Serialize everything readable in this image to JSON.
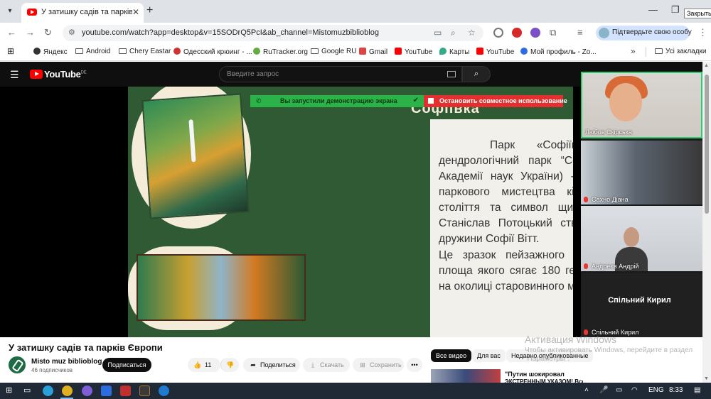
{
  "browser": {
    "tab_title": "У затишку садів та парків Європ",
    "tooltip_close": "Закрыть",
    "url": "youtube.com/watch?app=desktop&v=15SODrQ5PcI&ab_channel=Mistomuzbiblioblog",
    "profile_label": "Підтвердьте свою особу",
    "bookmarks": [
      "Яндекс",
      "Android",
      "Chery Eastar",
      "Одесский крюинг - ...",
      "RuTracker.org",
      "Google RU",
      "Gmail",
      "YouTube",
      "Карты",
      "YouTube",
      "Мой профиль - Zo..."
    ],
    "all_bookmarks": "Усі закладки"
  },
  "youtube": {
    "logo_text": "YouTube",
    "region": "DE",
    "search_placeholder": "Введите запрос"
  },
  "meeting": {
    "share_banner": "Вы запустили демонстрацию экрана",
    "stop_sharing": "Остановить совместное использование",
    "participants": [
      {
        "name": "Любов Скірська"
      },
      {
        "name": "Сахно Діана"
      },
      {
        "name": "Андреєв Андрій"
      },
      {
        "name": "Спільний Кирил",
        "display": "Спільний Кирил"
      }
    ]
  },
  "slide": {
    "heading": "Софіївка",
    "paragraph1": "Парк «Софіївка» (Національний дендрологічний парк “Софіївка” Національної Академії наук України) - це перлина садово-паркового мистецтва кінця 18 початок 19 століття та символ щирого кохання , який Станіслав Потоцький створив на честь своєї дружини Софії Вітт.",
    "paragraph2": "Це зразок пейзажного паркового мистецтва, площа якого сягає 180 гектарів і розташований на околиці старовинного міста Умані."
  },
  "video": {
    "title": "У затишку садів та парків Європи",
    "channel": "Misto muz biblioblog",
    "subscribers": "46 подписчиков",
    "subscribe": "Подписаться",
    "likes": "11",
    "share": "Поделиться",
    "download": "Скачать",
    "save": "Сохранить",
    "more": "•••"
  },
  "sidebar": {
    "chips": [
      "Все видео",
      "Для вас",
      "Недавно опубликованные"
    ],
    "rec_title": "\"Путин шокировал",
    "rec_subtitle": "ЭКСТРЕННЫМ УКАЗОМ! Все"
  },
  "watermark": {
    "line1": "Активация Windows",
    "line2": "Чтобы активировать Windows, перейдите в раздел \"Параметры\"."
  },
  "taskbar": {
    "lang": "ENG",
    "time": "8:33"
  }
}
